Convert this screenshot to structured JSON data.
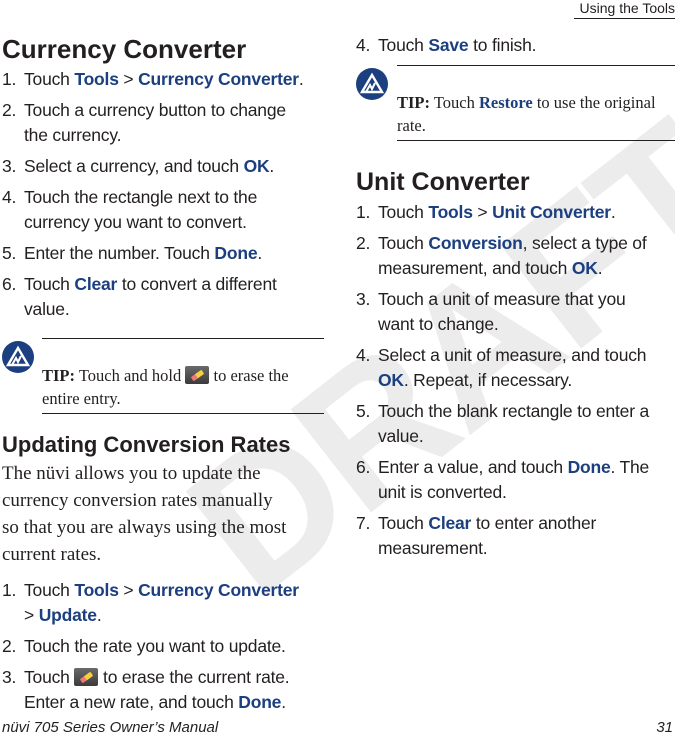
{
  "header": {
    "section": "Using the Tools"
  },
  "watermark": "DRAFT",
  "colors": {
    "keyword": "#1c3f7f",
    "tip_icon": "#1c3f7f"
  },
  "currency": {
    "title": "Currency Converter",
    "steps": [
      [
        {
          "t": "Touch "
        },
        {
          "t": "Tools",
          "k": 1
        },
        {
          "t": " > "
        },
        {
          "t": "Currency Converter",
          "k": 1
        },
        {
          "t": "."
        }
      ],
      [
        {
          "t": "Touch a currency button to change\nthe currency."
        }
      ],
      [
        {
          "t": "Select a currency, and touch "
        },
        {
          "t": "OK",
          "k": 1
        },
        {
          "t": "."
        }
      ],
      [
        {
          "t": "Touch the rectangle next to the\ncurrency you want to convert."
        }
      ],
      [
        {
          "t": "Enter the number. Touch "
        },
        {
          "t": "Done",
          "k": 1
        },
        {
          "t": "."
        }
      ],
      [
        {
          "t": "Touch "
        },
        {
          "t": "Clear",
          "k": 1
        },
        {
          "t": " to convert a different\nvalue."
        }
      ]
    ],
    "tip": {
      "label": "TIP:",
      "before": " Touch and hold ",
      "icon": "eraser-icon",
      "after": " to erase the\nentire entry."
    }
  },
  "updating": {
    "title": "Updating Conversion Rates",
    "body": "The nüvi allows you to update the\ncurrency conversion rates manually\nso that you are always using the most\ncurrent rates.",
    "steps": [
      [
        {
          "t": "Touch "
        },
        {
          "t": "Tools",
          "k": 1
        },
        {
          "t": " > "
        },
        {
          "t": "Currency Converter",
          "k": 1
        },
        {
          "t": "\n> "
        },
        {
          "t": "Update",
          "k": 1
        },
        {
          "t": "."
        }
      ],
      [
        {
          "t": "Touch the rate you want to update."
        }
      ],
      [
        {
          "t": "Touch "
        },
        {
          "icon": "eraser-icon"
        },
        {
          "t": " to erase the current rate.\nEnter a new rate, and touch "
        },
        {
          "t": "Done",
          "k": 1
        },
        {
          "t": "."
        }
      ]
    ]
  },
  "currency_cont": {
    "steps": [
      [
        {
          "t": "Touch "
        },
        {
          "t": "Save",
          "k": 1
        },
        {
          "t": " to finish."
        }
      ]
    ],
    "start": 4,
    "tip": {
      "label": "TIP:",
      "before": " Touch ",
      "keyword": "Restore",
      "after": " to use the original\nrate."
    }
  },
  "unit": {
    "title": "Unit Converter",
    "steps": [
      [
        {
          "t": "Touch "
        },
        {
          "t": "Tools",
          "k": 1
        },
        {
          "t": " > "
        },
        {
          "t": "Unit Converter",
          "k": 1
        },
        {
          "t": "."
        }
      ],
      [
        {
          "t": "Touch "
        },
        {
          "t": "Conversion",
          "k": 1
        },
        {
          "t": ", select a type of\nmeasurement, and touch "
        },
        {
          "t": "OK",
          "k": 1
        },
        {
          "t": "."
        }
      ],
      [
        {
          "t": "Touch a unit of measure that you\nwant to change."
        }
      ],
      [
        {
          "t": "Select a unit of measure, and touch\n"
        },
        {
          "t": "OK",
          "k": 1
        },
        {
          "t": ". Repeat, if necessary."
        }
      ],
      [
        {
          "t": "Touch the blank rectangle to enter a\nvalue."
        }
      ],
      [
        {
          "t": "Enter a value, and touch "
        },
        {
          "t": "Done",
          "k": 1
        },
        {
          "t": ". The\nunit is converted."
        }
      ],
      [
        {
          "t": "Touch "
        },
        {
          "t": "Clear",
          "k": 1
        },
        {
          "t": " to enter another\nmeasurement."
        }
      ]
    ]
  },
  "footer": {
    "manual": "nüvi 705 Series Owner’s Manual",
    "page": "31"
  }
}
